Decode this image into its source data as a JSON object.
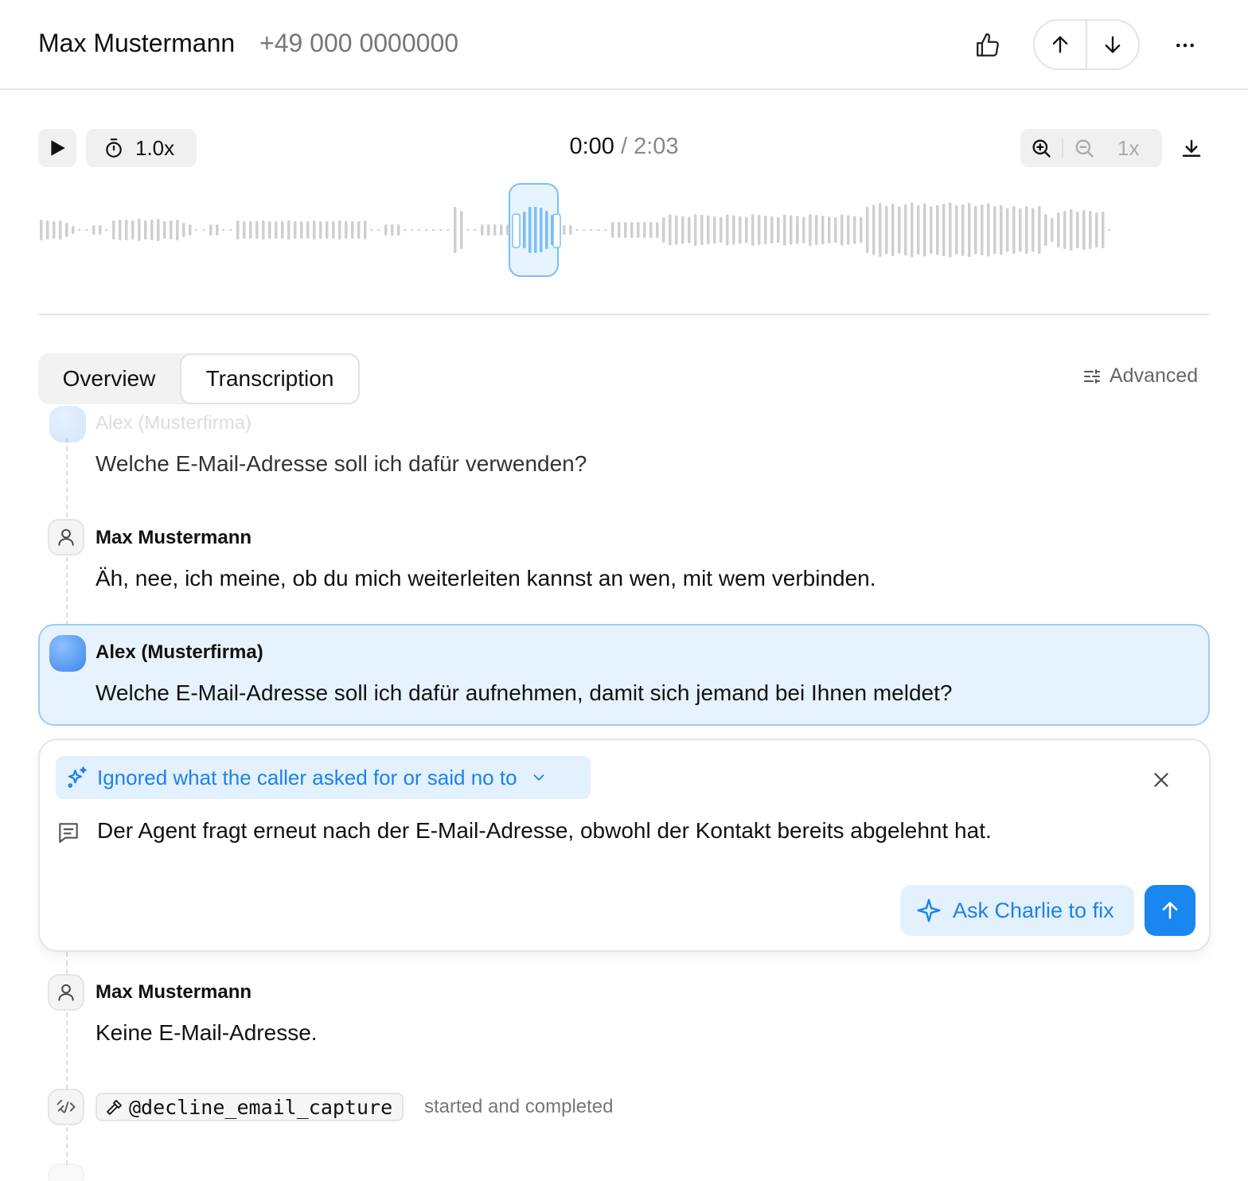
{
  "header": {
    "caller_name": "Max Mustermann",
    "caller_phone": "+49 000 0000000"
  },
  "player": {
    "speed": "1.0x",
    "current_time": "0:00",
    "separator": " / ",
    "total_time": "2:03",
    "zoom_level": "1x",
    "progress": 0.0
  },
  "tabs": {
    "overview": "Overview",
    "transcription": "Transcription",
    "active": "Transcription",
    "advanced": "Advanced"
  },
  "transcript": [
    {
      "speaker": "Alex (Musterfirma)",
      "role": "agent",
      "text": "Welche E-Mail-Adresse soll ich dafür verwenden?"
    },
    {
      "speaker": "Max Mustermann",
      "role": "user",
      "text": "Äh, nee, ich meine, ob du mich weiterleiten kannst an wen, mit wem verbinden."
    },
    {
      "speaker": "Alex (Musterfirma)",
      "role": "agent",
      "text": "Welche E-Mail-Adresse soll ich dafür aufnehmen, damit sich jemand bei Ihnen meldet?"
    },
    {
      "speaker": "Max Mustermann",
      "role": "user",
      "text": "Keine E-Mail-Adresse."
    }
  ],
  "feedback": {
    "issue": "Ignored what the caller asked for or said no to",
    "note": "Der Agent fragt erneut nach der E-Mail-Adresse, obwohl der Kontakt bereits abgelehnt hat.",
    "ask_label": "Ask Charlie to fix"
  },
  "tool_call": {
    "name": "@decline_email_capture",
    "status": "started and completed"
  },
  "colors": {
    "accent": "#1a86f0",
    "accent_light": "#e3f0fd",
    "highlight_bg": "#e6f2fd",
    "highlight_border": "#9ccdf7",
    "wave_bar": "#cfcfcf",
    "wave_active": "#7cbef5"
  },
  "icons": {
    "thumb": "thumbs-up-icon",
    "prev": "arrow-up-icon",
    "next": "arrow-down-icon",
    "more": "more-horizontal-icon",
    "play": "play-icon",
    "speed": "stopwatch-icon",
    "zoom_in": "zoom-in-icon",
    "zoom_out": "zoom-out-icon",
    "download": "download-icon",
    "advanced": "sliders-icon",
    "issue": "sparkles-icon",
    "note": "message-icon",
    "tool": "tool-icon",
    "close": "close-icon",
    "send": "arrow-up-icon"
  }
}
